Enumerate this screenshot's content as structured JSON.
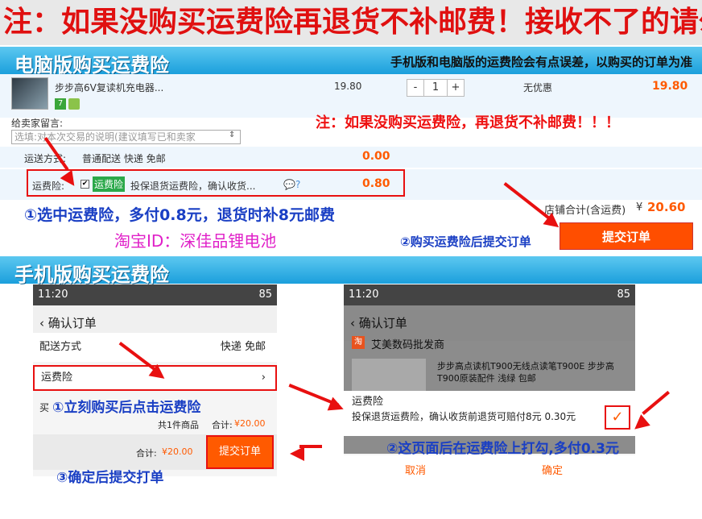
{
  "banner": "注：如果没购买运费险再退货不补邮费！接收不了的请勿拍",
  "pc": {
    "header": "电脑版购买运费险",
    "header_note": "手机版和电脑版的运费险会有点误差，以购买的订单为准",
    "product_name": "步步高6V复读机充电器...",
    "price": "19.80",
    "qty_minus": "-",
    "qty": "1",
    "qty_plus": "+",
    "discount": "无优惠",
    "subtotal": "19.80",
    "red_note": "注：如果没购买运费险，再退货不补邮费！！！",
    "message_label": "给卖家留言:",
    "message_placeholder": "选填:对本次交易的说明(建议填写已和卖家",
    "shipping_label": "运送方式:",
    "shipping_value": "普通配送 快递 免邮",
    "shipping_price": "0.00",
    "insurance_label": "运费险:",
    "insurance_tag": "运费险",
    "insurance_desc": "投保退货运费险，确认收货...",
    "insurance_price": "0.80",
    "step1": "①选中运费险，多付0.8元，退货时补8元邮费",
    "shop_total_label": "店铺合计(含运费)",
    "shop_total_currency": "¥",
    "shop_total_value": "20.60",
    "taobao_id": "淘宝ID：深佳品锂电池",
    "step2": "②购买运费险后提交订单",
    "submit": "提交订单"
  },
  "mobile": {
    "header": "手机版购买运费险",
    "left": {
      "time": "11:20",
      "battery": "85",
      "nav_title": "确认订单",
      "delivery_label": "配送方式",
      "delivery_value": "快递 免邮",
      "insurance_label": "运费险",
      "partial": "买",
      "step1": "①立刻购买后点击运费险",
      "count_text": "共1件商品",
      "total_label": "合计:",
      "total_value": "¥20.00",
      "bottom_total_label": "合计:",
      "bottom_total_value": "¥20.00",
      "submit": "提交订单",
      "step3": "③确定后提交打单"
    },
    "right": {
      "time": "11:20",
      "battery": "85",
      "nav_title": "确认订单",
      "shop_name": "艾美数码批发商",
      "product": "步步高点读机T900无线点读笔T900E 步步高T900原装配件 浅绿 包邮",
      "popup_title": "运费险",
      "popup_desc": "投保退货运费险，确认收货前退货可赔付8元 0.30元",
      "step2": "②这页面后在运费险上打勾,多付0.3元",
      "cancel": "取消",
      "confirm": "确定"
    }
  }
}
